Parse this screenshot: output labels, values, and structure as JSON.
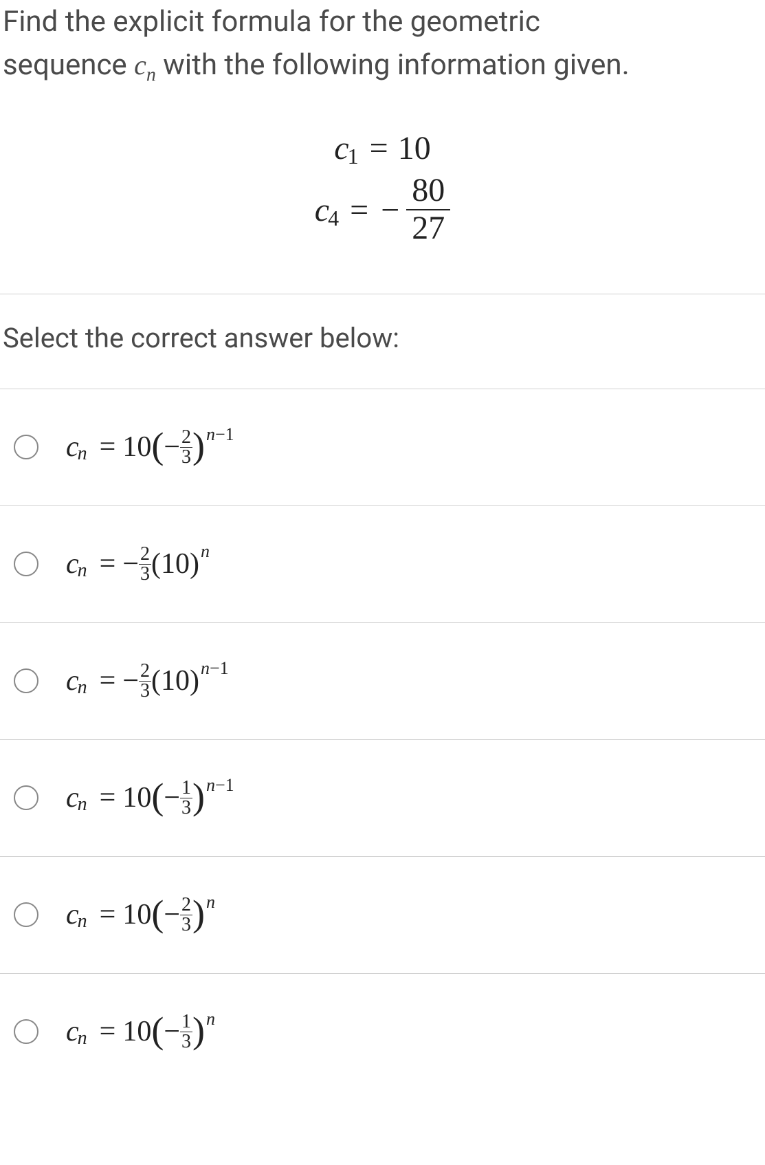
{
  "question": {
    "line1_part1": "Find the explicit formula for the geometric",
    "line2_part1": "sequence ",
    "seq_var": "c",
    "seq_sub": "n",
    "line2_part2": " with the following information given."
  },
  "equations": {
    "eq1_var": "c",
    "eq1_sub": "1",
    "eq1_eq": "=",
    "eq1_rhs": "10",
    "eq2_var": "c",
    "eq2_sub": "4",
    "eq2_eq": "=",
    "eq2_minus": "−",
    "eq2_num": "80",
    "eq2_den": "27"
  },
  "prompt": "Select the correct answer below:",
  "options": [
    {
      "c": "c",
      "n": "n",
      "eq": "=",
      "coef": "10",
      "minus": "−",
      "fn": "2",
      "fd": "3",
      "exp_var": "n",
      "exp_rest": "−1",
      "type": "paren"
    },
    {
      "c": "c",
      "n": "n",
      "eq": "=",
      "minus": "−",
      "fn": "2",
      "fd": "3",
      "base": "(10)",
      "exp_var": "n",
      "exp_rest": "",
      "type": "frac_front"
    },
    {
      "c": "c",
      "n": "n",
      "eq": "=",
      "minus": "−",
      "fn": "2",
      "fd": "3",
      "base": "(10)",
      "exp_var": "n",
      "exp_rest": "−1",
      "type": "frac_front"
    },
    {
      "c": "c",
      "n": "n",
      "eq": "=",
      "coef": "10",
      "minus": "−",
      "fn": "1",
      "fd": "3",
      "exp_var": "n",
      "exp_rest": "−1",
      "type": "paren"
    },
    {
      "c": "c",
      "n": "n",
      "eq": "=",
      "coef": "10",
      "minus": "−",
      "fn": "2",
      "fd": "3",
      "exp_var": "n",
      "exp_rest": "",
      "type": "paren"
    },
    {
      "c": "c",
      "n": "n",
      "eq": "=",
      "coef": "10",
      "minus": "−",
      "fn": "1",
      "fd": "3",
      "exp_var": "n",
      "exp_rest": "",
      "type": "paren"
    }
  ]
}
